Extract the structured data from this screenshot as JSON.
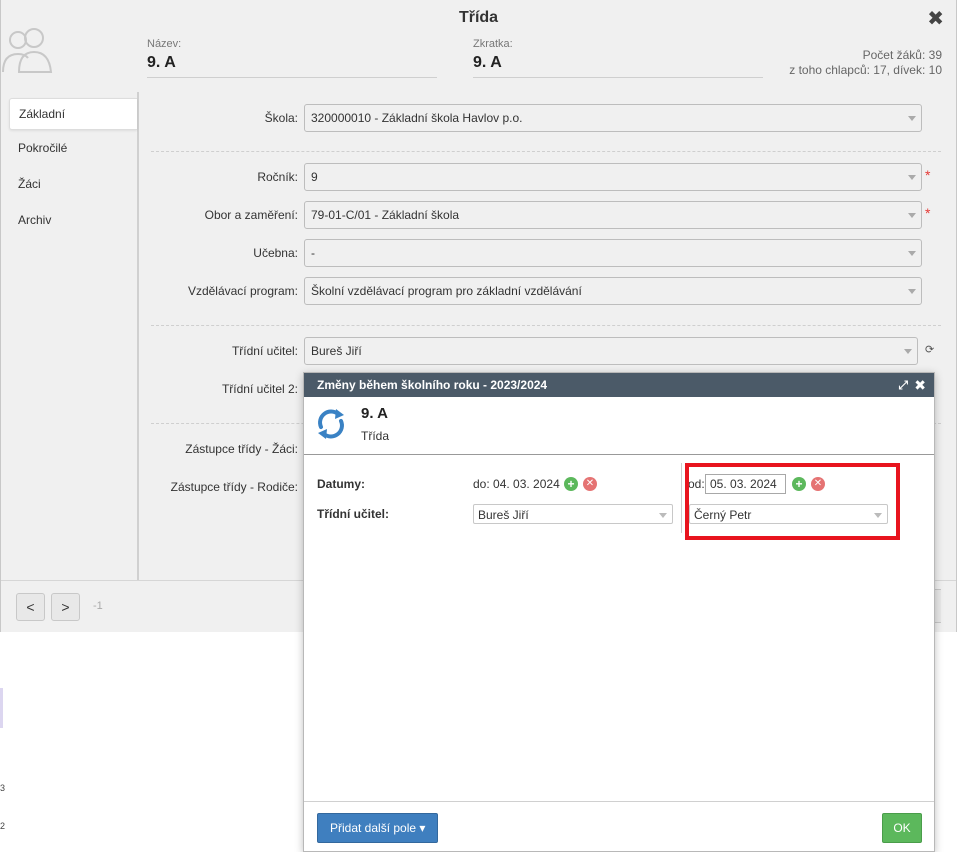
{
  "dialog": {
    "title": "Třída",
    "name_label": "Název:",
    "name_value": "9. A",
    "abbr_label": "Zkratka:",
    "abbr_value": "9. A",
    "count_line1": "Počet žáků: 39",
    "count_line2": "z toho chlapců: 17, dívek: 10"
  },
  "tabs": [
    {
      "label": "Základní",
      "active": true
    },
    {
      "label": "Pokročilé",
      "active": false
    },
    {
      "label": "Žáci",
      "active": false
    },
    {
      "label": "Archiv",
      "active": false
    }
  ],
  "form": {
    "school_label": "Škola:",
    "school_value": "320000010 - Základní škola Havlov p.o.",
    "grade_label": "Ročník:",
    "grade_value": "9",
    "field_label": "Obor a zaměření:",
    "field_value": "79-01-C/01 - Základní škola",
    "room_label": "Učebna:",
    "room_value": "-",
    "program_label": "Vzdělávací program:",
    "program_value": "Školní vzdělávací program pro základní vzdělávání",
    "teacher_label": "Třídní učitel:",
    "teacher_value": "Bureš Jiří",
    "teacher2_label": "Třídní učitel 2:",
    "rep_students_label": "Zástupce třídy - Žáci:",
    "rep_parents_label": "Zástupce třídy - Rodiče:",
    "required_mark": "*"
  },
  "footer": {
    "prev_label": "<",
    "next_label": ">",
    "page_value": "-1"
  },
  "modal": {
    "title": "Změny během školního roku - 2023/2024",
    "class_name": "9. A",
    "class_type": "Třída",
    "dates_label": "Datumy:",
    "teacher_label": "Třídní učitel:",
    "period1_text": "do: 04. 03. 2024",
    "period1_teacher": "Bureš Jiří",
    "period2_prefix": "od:",
    "period2_date": "05. 03. 2024",
    "period2_teacher": "Černý Petr",
    "add_button": "Přidat další pole ▾",
    "ok_button": "OK"
  },
  "colors": {
    "modal_header": "#4b5a68",
    "add_button": "#3f7fbf",
    "ok_button": "#5cb85c",
    "highlight": "#e8141e",
    "required": "#e53935"
  },
  "icons": {
    "close": "close-icon",
    "expand": "expand-icon",
    "sync": "sync-icon",
    "avatar": "group-avatar-icon"
  }
}
